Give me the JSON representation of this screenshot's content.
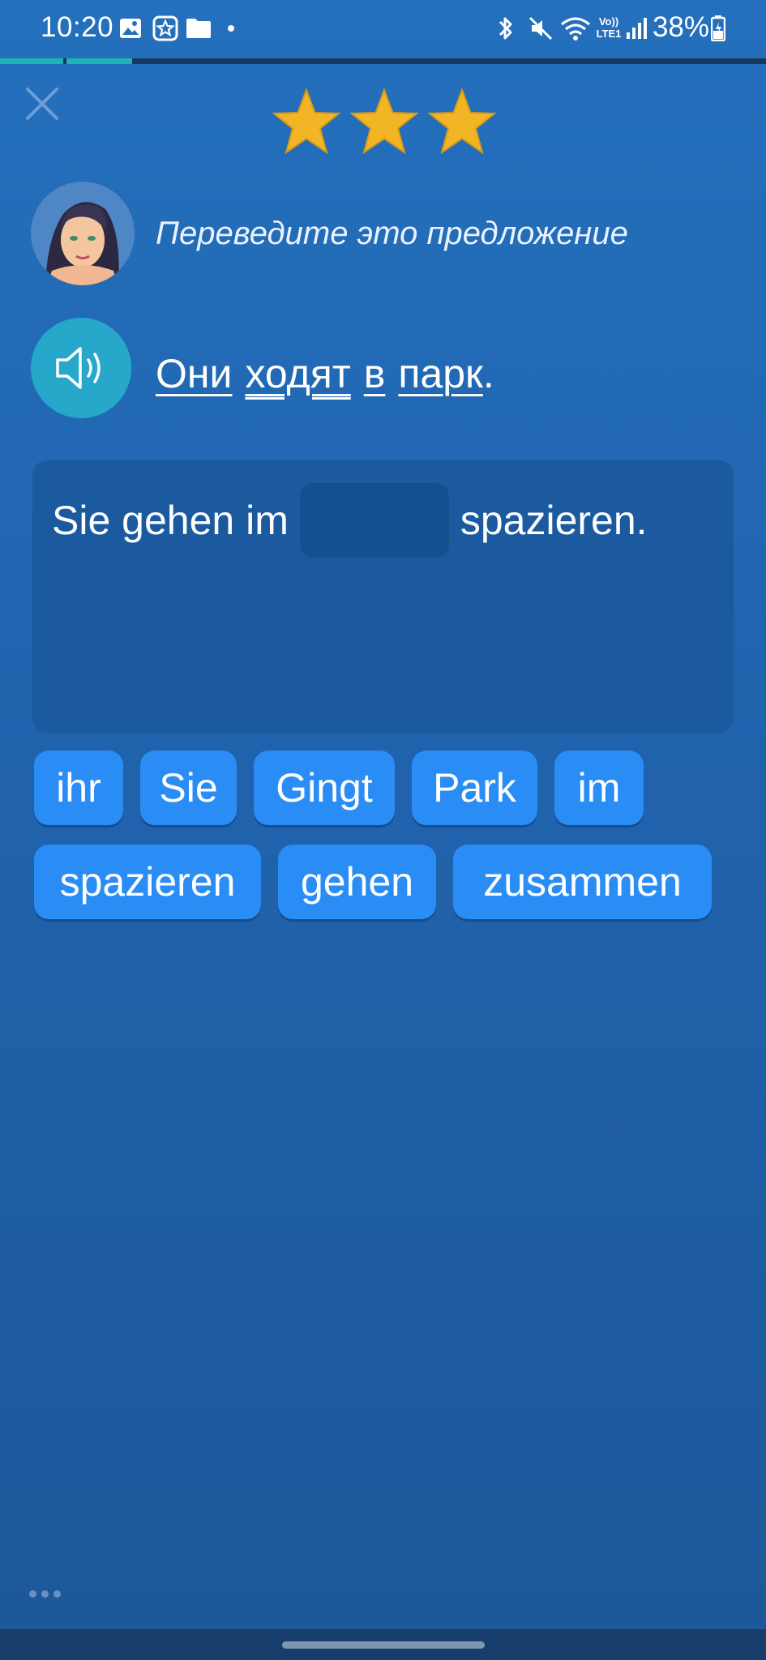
{
  "status_bar": {
    "time": "10:20",
    "battery": "38%",
    "icons": [
      "image-icon",
      "star-badge-icon",
      "folder-icon",
      "dot-icon",
      "bluetooth-icon",
      "mute-icon",
      "wifi-icon",
      "volte-icon",
      "signal-icon",
      "battery-icon"
    ],
    "network_label_top": "Vo))",
    "network_label_bottom": "LTE1"
  },
  "progress": {
    "segments_completed": 2,
    "fraction": 0.17
  },
  "header": {
    "close_icon": "close-icon",
    "stars": 3
  },
  "prompt": {
    "instruction": "Переведите это предложение",
    "sentence_words": [
      "Они",
      "ходят",
      "в",
      "парк"
    ],
    "sentence_end": "."
  },
  "answer": {
    "before_blank": "Sie gehen im",
    "after_blank": "spazieren."
  },
  "word_bank": {
    "row1": [
      "ihr",
      "Sie",
      "Gingt",
      "Park",
      "im"
    ],
    "row2": [
      "spazieren",
      "gehen",
      "zusammen"
    ]
  },
  "colors": {
    "background": "#2167b1",
    "chip": "#2a8df5",
    "answer_box": "#1b5a9f",
    "speaker": "#27a7c9",
    "progress": "#1fb3b8",
    "star": "#f2b526"
  }
}
